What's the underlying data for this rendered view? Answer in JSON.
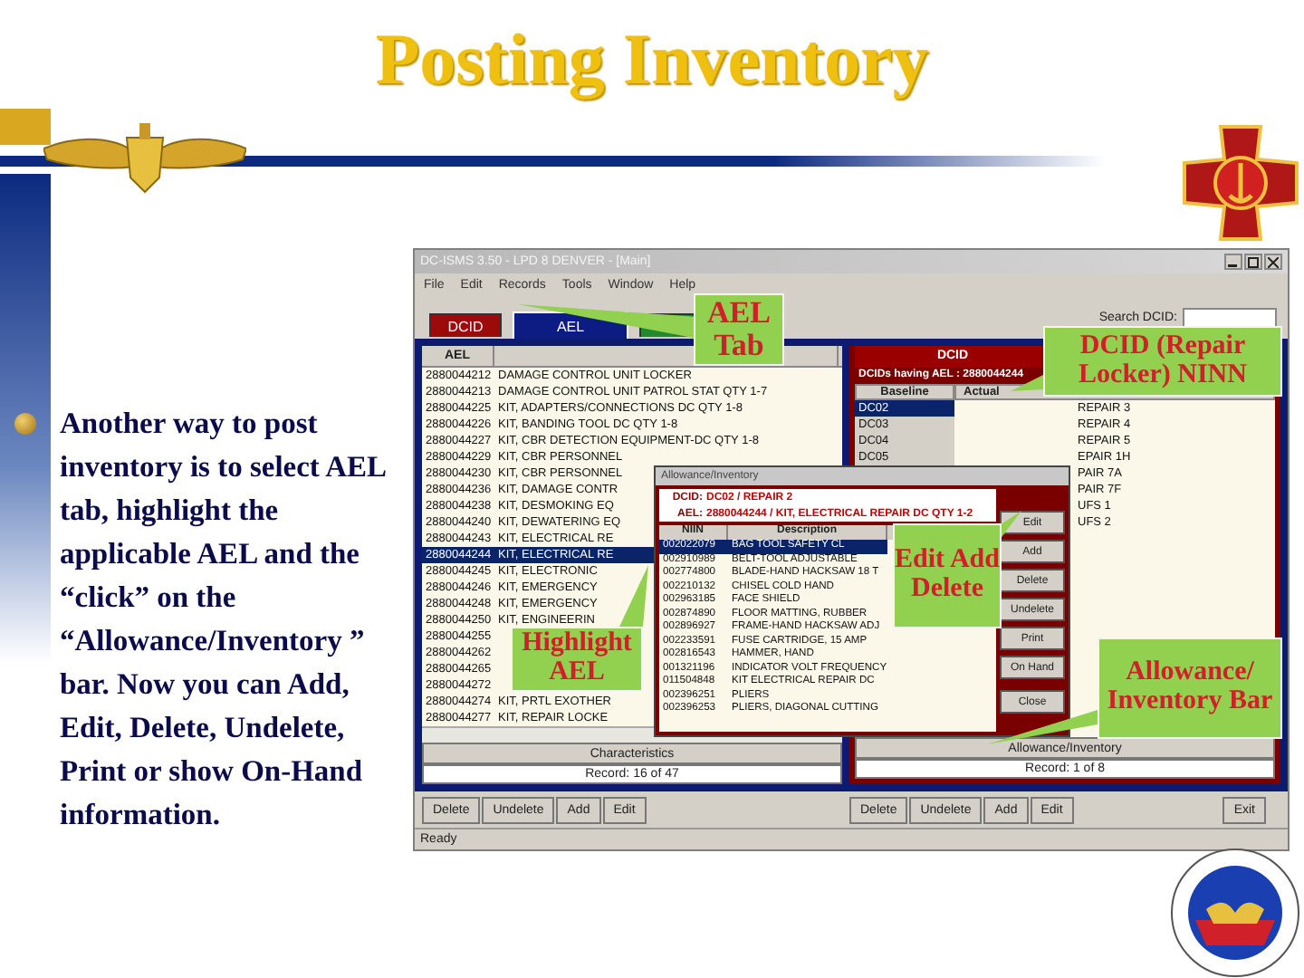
{
  "slide": {
    "title": "Posting Inventory",
    "bullet_text": "Another way to post inventory is to select AEL tab, highlight the applicable AEL and the “click” on the “Allowance/Inventory ” bar.  Now you can Add, Edit, Delete, Undelete, Print or show On-Hand information."
  },
  "app": {
    "title": "DC-ISMS 3.50 - LPD 8 DENVER - [Main]",
    "menu": [
      "File",
      "Edit",
      "Records",
      "Tools",
      "Window",
      "Help"
    ],
    "tabs": [
      {
        "label": "DCID",
        "selected": false,
        "color": "#9c0a0a"
      },
      {
        "label": "AEL",
        "selected": true,
        "color": "#0c1c82"
      },
      {
        "selected": false,
        "color": "#1f8a2e"
      }
    ],
    "search_label": "Search DCID:",
    "ael_panel": {
      "column": "AEL",
      "rows": [
        {
          "ael": "2880044212",
          "description": "DAMAGE CONTROL UNIT LOCKER",
          "selected": false
        },
        {
          "ael": "2880044213",
          "description": "DAMAGE CONTROL UNIT PATROL STAT QTY 1-7",
          "selected": false
        },
        {
          "ael": "2880044225",
          "description": "KIT, ADAPTERS/CONNECTIONS DC QTY 1-8",
          "selected": false
        },
        {
          "ael": "2880044226",
          "description": "KIT, BANDING TOOL DC QTY 1-8",
          "selected": false
        },
        {
          "ael": "2880044227",
          "description": "KIT, CBR DETECTION EQUIPMENT-DC QTY 1-8",
          "selected": false
        },
        {
          "ael": "2880044229",
          "description": "KIT, CBR PERSONNEL",
          "selected": false
        },
        {
          "ael": "2880044230",
          "description": "KIT, CBR PERSONNEL",
          "selected": false
        },
        {
          "ael": "2880044236",
          "description": "KIT, DAMAGE CONTR",
          "selected": false
        },
        {
          "ael": "2880044238",
          "description": "KIT, DESMOKING EQ",
          "selected": false
        },
        {
          "ael": "2880044240",
          "description": "KIT, DEWATERING EQ",
          "selected": false
        },
        {
          "ael": "2880044243",
          "description": "KIT, ELECTRICAL RE",
          "selected": false
        },
        {
          "ael": "2880044244",
          "description": "KIT, ELECTRICAL RE",
          "selected": true
        },
        {
          "ael": "2880044245",
          "description": "KIT, ELECTRONIC",
          "selected": false
        },
        {
          "ael": "2880044246",
          "description": "KIT, EMERGENCY",
          "selected": false
        },
        {
          "ael": "2880044248",
          "description": "KIT, EMERGENCY",
          "selected": false
        },
        {
          "ael": "2880044250",
          "description": "KIT, ENGINEERIN",
          "selected": false
        },
        {
          "ael": "2880044255",
          "selected": false
        },
        {
          "ael": "2880044262",
          "selected": false
        },
        {
          "ael": "2880044265",
          "selected": false
        },
        {
          "ael": "2880044272",
          "selected": false
        },
        {
          "ael": "2880044274",
          "description": "KIT, PRTL EXOTHER",
          "selected": false
        },
        {
          "ael": "2880044277",
          "description": "KIT, REPAIR LOCKE",
          "selected": false
        }
      ],
      "characteristics": "Characteristics",
      "record": "Record: 16 of 47",
      "buttons": [
        "Delete",
        "Undelete",
        "Add",
        "Edit"
      ]
    },
    "dcid_panel": {
      "header": "DCID",
      "caption": "DCIDs having AEL : 2880044244",
      "columns": [
        "Baseline",
        "Actual"
      ],
      "baseline": [
        {
          "label": "DC02",
          "selected": true
        },
        {
          "label": "DC03",
          "selected": false
        },
        {
          "label": "DC04",
          "selected": false
        },
        {
          "label": "DC05",
          "selected": false
        }
      ],
      "actual": [
        "REPAIR 3",
        "REPAIR 4",
        "REPAIR 5",
        "EPAIR 1H",
        "PAIR 7A",
        "PAIR 7F",
        "UFS 1",
        "UFS 2"
      ],
      "bar": "Allowance/Inventory",
      "record": "Record: 1 of 8",
      "buttons": [
        "Delete",
        "Undelete",
        "Add",
        "Edit"
      ]
    },
    "exit": "Exit",
    "status": "Ready",
    "popup": {
      "title": "Allowance/Inventory",
      "dcid_label": "DCID:",
      "dcid": "DC02 / REPAIR 2",
      "ael_label": "AEL:",
      "ael": "2880044244 / KIT, ELECTRICAL REPAIR DC QTY 1-2",
      "columns": [
        "NIIN",
        "Description"
      ],
      "rows": [
        {
          "niin": "002022079",
          "description": "BAG TOOL SAFETY CL",
          "selected": true
        },
        {
          "niin": "002910989",
          "description": "BELT-TOOL ADJUSTABLE",
          "selected": false
        },
        {
          "niin": "002774800",
          "description": "BLADE-HAND HACKSAW 18 T",
          "selected": false
        },
        {
          "niin": "002210132",
          "description": "CHISEL COLD HAND",
          "selected": false
        },
        {
          "niin": "002963185",
          "description": "FACE SHIELD",
          "selected": false
        },
        {
          "niin": "002874890",
          "description": "FLOOR MATTING, RUBBER",
          "selected": false
        },
        {
          "niin": "002896927",
          "description": "FRAME-HAND HACKSAW ADJ",
          "selected": false
        },
        {
          "niin": "002233591",
          "description": "FUSE CARTRIDGE, 15 AMP",
          "selected": false
        },
        {
          "niin": "002816543",
          "description": "HAMMER, HAND",
          "selected": false
        },
        {
          "niin": "001321196",
          "description": "INDICATOR VOLT FREQUENCY",
          "selected": false
        },
        {
          "niin": "011504848",
          "description": "KIT ELECTRICAL REPAIR DC",
          "selected": false
        },
        {
          "niin": "002396251",
          "description": "PLIERS",
          "selected": false
        },
        {
          "niin": "002396253",
          "description": "PLIERS, DIAGONAL CUTTING",
          "selected": false
        }
      ],
      "buttons": [
        "Edit",
        "Add",
        "Delete",
        "Undelete",
        "Print",
        "On Hand",
        "Close"
      ]
    }
  },
  "callouts": [
    {
      "text": "AEL Tab"
    },
    {
      "text": "DCID (Repair Locker) NINN"
    },
    {
      "text": "Edit Add Delete"
    },
    {
      "text": "Highlight AEL"
    },
    {
      "text": "Allowance/ Inventory Bar"
    }
  ]
}
